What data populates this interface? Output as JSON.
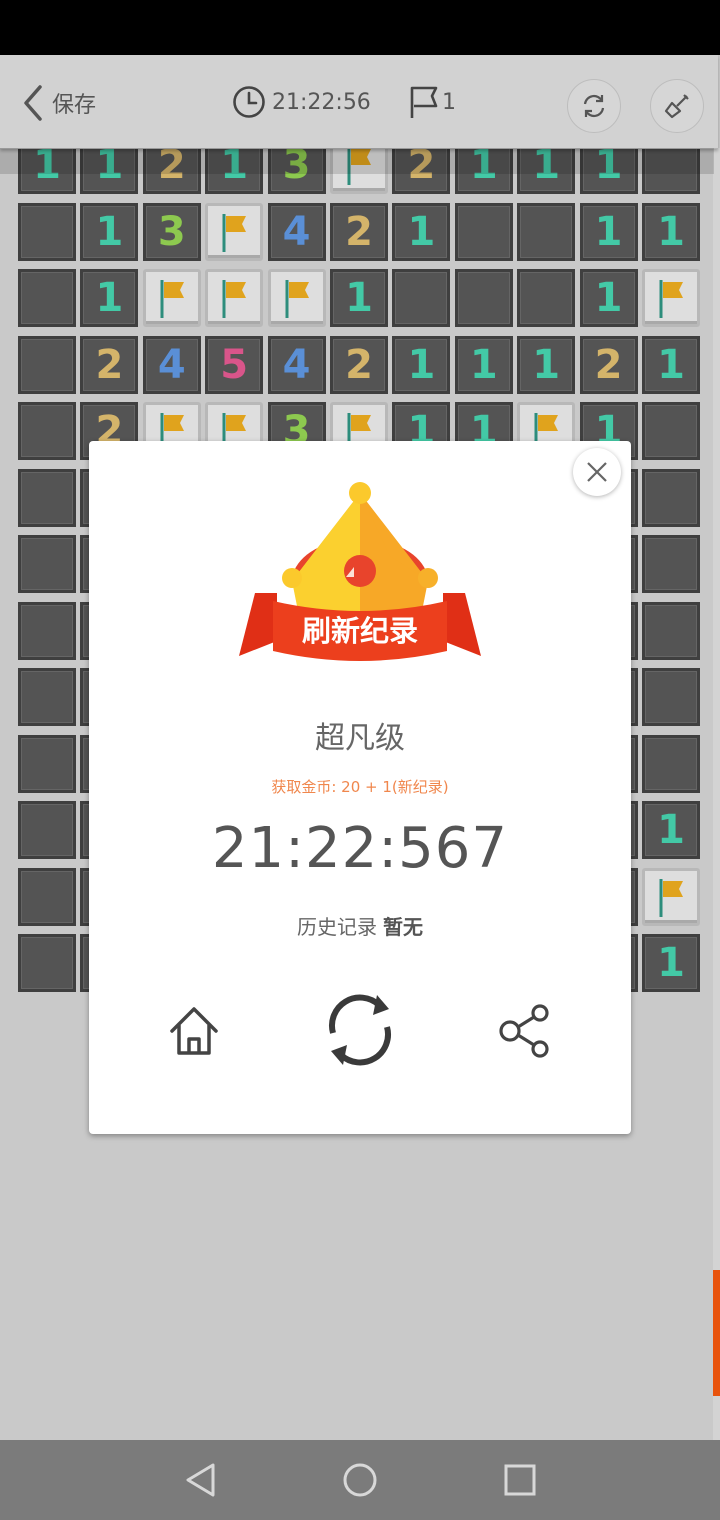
{
  "header": {
    "save_label": "保存",
    "timer": "21:22:56",
    "flag_count": "1"
  },
  "board": {
    "rows": [
      [
        "1",
        "1",
        "2",
        "1",
        "3",
        "F",
        "2",
        "1",
        "1",
        "1",
        ""
      ],
      [
        "",
        "1",
        "3",
        "F",
        "4",
        "2",
        "1",
        "",
        "",
        "1",
        "1"
      ],
      [
        "",
        "1",
        "F",
        "F",
        "F",
        "1",
        "",
        "",
        "",
        "1",
        "F"
      ],
      [
        "",
        "2",
        "4",
        "5",
        "4",
        "2",
        "1",
        "1",
        "1",
        "2",
        "1"
      ],
      [
        "",
        "2",
        "F",
        "F",
        "3",
        "F",
        "1",
        "1",
        "F",
        "1",
        ""
      ],
      [
        "",
        "",
        "",
        "",
        "",
        "",
        "",
        "",
        "",
        "",
        ""
      ],
      [
        "",
        "",
        "",
        "",
        "",
        "",
        "",
        "",
        "",
        "",
        ""
      ],
      [
        "",
        "",
        "",
        "",
        "",
        "",
        "",
        "",
        "",
        "",
        ""
      ],
      [
        "",
        "",
        "",
        "",
        "",
        "",
        "",
        "",
        "",
        "",
        ""
      ],
      [
        "",
        "",
        "",
        "",
        "",
        "",
        "",
        "",
        "",
        "",
        ""
      ],
      [
        "",
        "",
        "",
        "",
        "",
        "",
        "",
        "",
        "",
        "",
        "1"
      ],
      [
        "",
        "",
        "",
        "",
        "",
        "",
        "",
        "",
        "",
        "",
        "F"
      ],
      [
        "",
        "",
        "",
        "",
        "",
        "",
        "",
        "",
        "",
        "",
        "1"
      ]
    ],
    "number_colors": {
      "1": "#43c9a6",
      "2": "#d4b46a",
      "3": "#8dc94f",
      "4": "#5a8fd6",
      "5": "#d9558a"
    }
  },
  "dialog": {
    "banner_text": "刷新纪录",
    "level": "超凡级",
    "coins": "获取金币: 20 + 1(新纪录)",
    "time": "21:22:567",
    "history_label": "历史记录",
    "history_value": "暂无"
  },
  "icons": {
    "back": "chevron-left-icon",
    "timer": "clock-icon",
    "flag": "flag-icon",
    "restart": "refresh-icon",
    "tool": "shovel-icon",
    "close": "close-icon",
    "home": "home-icon",
    "replay": "replay-icon",
    "share": "share-icon"
  },
  "colors": {
    "accent": "#e8530c",
    "banner_red": "#e83c1c",
    "crown_yellow": "#f9c92f"
  }
}
